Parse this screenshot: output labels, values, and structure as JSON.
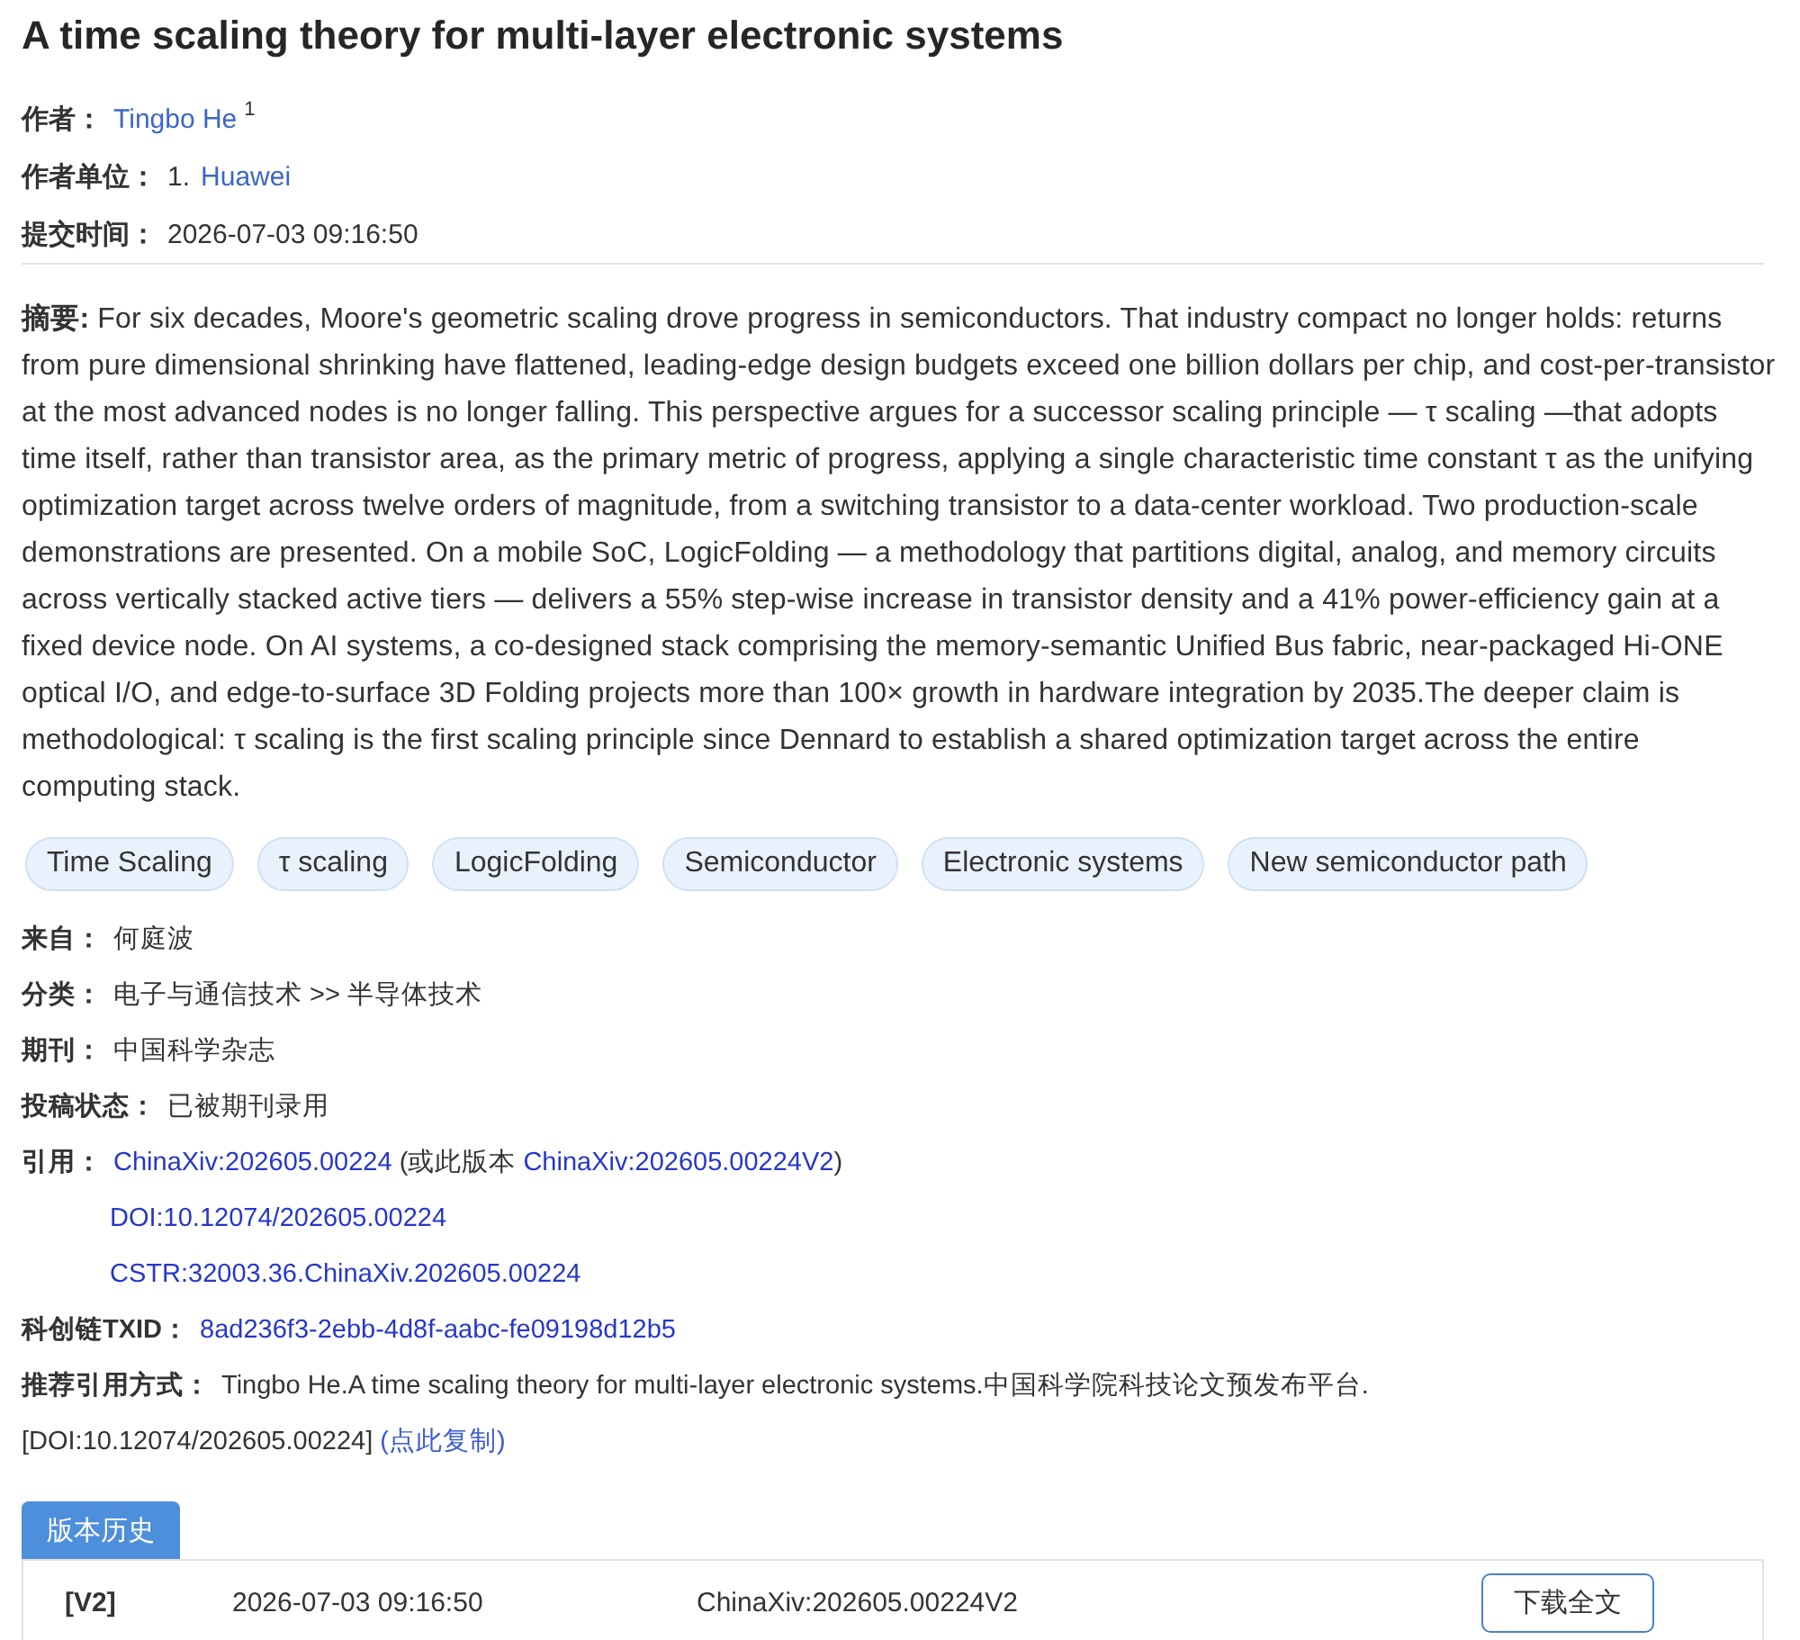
{
  "title": "A time scaling theory for multi-layer electronic systems",
  "header_fields": [
    {
      "kind": "authors",
      "label": "作者：",
      "authors": [
        {
          "name": "Tingbo He",
          "mark": "1"
        }
      ]
    },
    {
      "kind": "affiliations",
      "label": "作者单位：",
      "affiliations": [
        {
          "number": "1.",
          "name": "Huawei"
        }
      ]
    },
    {
      "kind": "text",
      "label": "提交时间：",
      "value": "2026-07-03 09:16:50"
    }
  ],
  "abstract": "**摘要:** For six decades, Moore's geometric scaling drove progress in semiconductors. That industry compact no longer holds: returns from pure dimensional shrinking have flattened, leading-edge design budgets exceed one billion dollars per chip, and cost-per-transistor at the most advanced nodes is no longer falling. This perspective argues for a successor scaling principle — τ scaling —that adopts time itself, rather than transistor area, as the primary metric of progress, applying a single characteristic time constant τ as the unifying optimization target across twelve orders of magnitude, from a switching transistor to a data-center workload. Two production-scale demonstrations are presented. On a mobile SoC, LogicFolding — a methodology that partitions digital, analog, and memory circuits across vertically stacked active tiers — delivers a 55% step-wise increase in transistor density and a 41% power-efficiency gain at a fixed device node. On AI systems, a co-designed stack comprising the memory-semantic Unified Bus fabric, near-packaged Hi-ONE optical I/O, and edge-to-surface 3D Folding projects more than 100× growth in hardware integration by 2035.The deeper claim is methodological: τ scaling is the first scaling principle since Dennard to establish a shared optimization target across the entire computing stack.",
  "keywords": [
    "Time Scaling",
    "τ scaling",
    "LogicFolding",
    "Semiconductor",
    "Electronic systems",
    "New semiconductor path"
  ],
  "details": [
    {
      "kind": "text",
      "label": "来自：",
      "value": "何庭波"
    },
    {
      "kind": "text",
      "label": "分类：",
      "value": "电子与通信技术 >> 半导体技术"
    },
    {
      "kind": "text",
      "label": "期刊：",
      "value": "中国科学杂志"
    },
    {
      "kind": "text",
      "label": "投稿状态：",
      "value": "已被期刊录用"
    },
    {
      "kind": "citations",
      "label": "引用：",
      "primary": "ChinaXiv:202605.00224",
      "version_note": "(或此版本",
      "version_link": "ChinaXiv:202605.00224V2",
      "version_close": ")",
      "doi": "DOI:10.12074/202605.00224",
      "cstr": "CSTR:32003.36.ChinaXiv.202605.00224"
    },
    {
      "kind": "link",
      "label": "科创链TXID：",
      "value": "8ad236f3-2ebb-4d8f-aabc-fe09198d12b5"
    },
    {
      "kind": "recommended",
      "label": "推荐引用方式：",
      "value": "Tingbo He.A time scaling theory for multi-layer electronic systems.中国科学院科技论文预发布平台.",
      "doi": "[DOI:10.12074/202605.00224]",
      "copy_link": "(点此复制)"
    }
  ],
  "version_history": {
    "tab": {
      "label": "版本历史",
      "selected": true
    },
    "rows": [
      {
        "version": "[V2]",
        "date": "2026-07-03 09:16:50",
        "id": "ChinaXiv:202605.00224V2",
        "button": "下载全文"
      }
    ]
  }
}
